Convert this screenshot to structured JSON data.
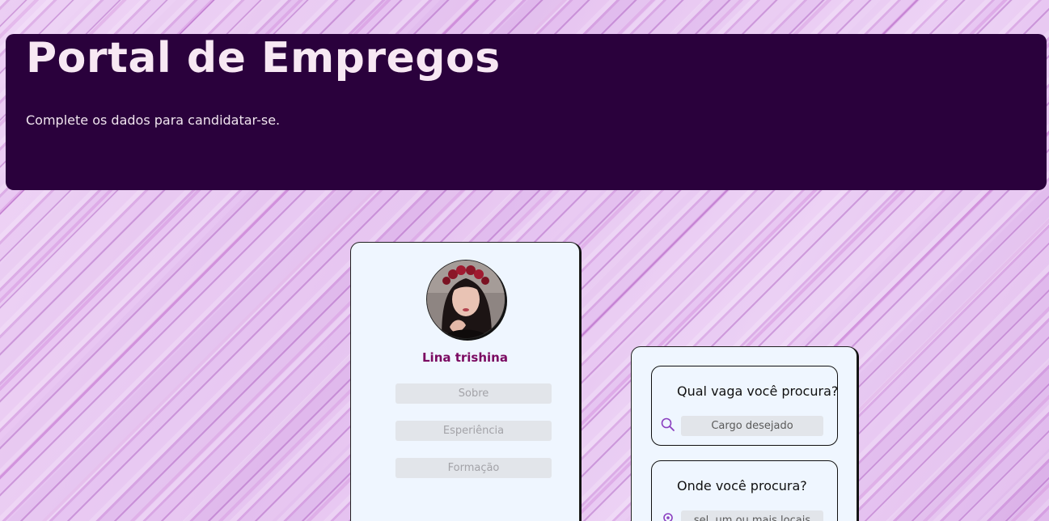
{
  "header": {
    "title": "Portal de Empregos",
    "subtitle": "Complete os dados para candidatar-se."
  },
  "profile": {
    "name": "Lina trishina",
    "buttons": [
      {
        "label": "Sobre"
      },
      {
        "label": "Esperiência"
      },
      {
        "label": "Formação"
      }
    ]
  },
  "search": {
    "job": {
      "question": "Qual vaga você procura?",
      "placeholder": "Cargo desejado",
      "icon": "search-icon"
    },
    "location": {
      "question": "Onde você procura?",
      "placeholder": "sel. um ou mais locais",
      "icon": "location-pin-icon"
    }
  },
  "colors": {
    "header_bg": "#2a013c",
    "name_color": "#7b0a62",
    "card_bg": "#eff6ff",
    "icon_accent": "#8b3fc0"
  }
}
